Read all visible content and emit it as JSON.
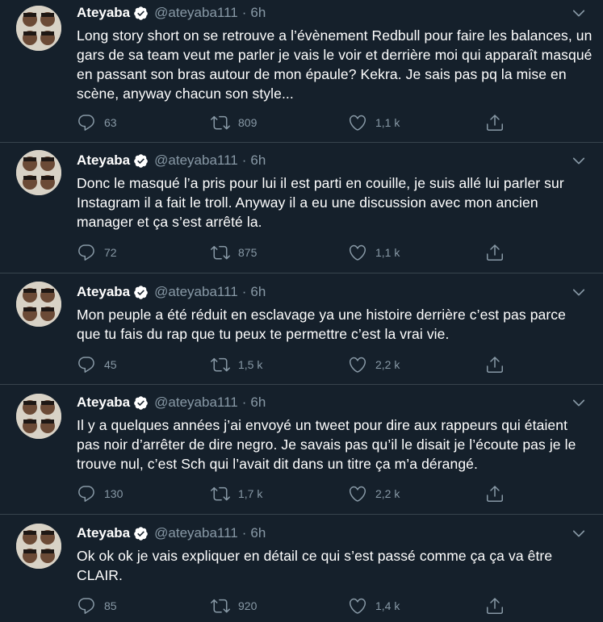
{
  "tweets": [
    {
      "name": "Ateyaba",
      "handle": "@ateyaba111",
      "separator": "·",
      "time": "6h",
      "text": "Long story short on se retrouve a l’évènement Redbull pour faire les balances, un gars de sa team veut me parler je vais le voir et derrière moi qui apparaît masqué en passant son bras autour de mon épaule? Kekra. Je sais pas pq la mise en scène, anyway chacun son style...",
      "replies": "63",
      "retweets": "809",
      "likes": "1,1 k"
    },
    {
      "name": "Ateyaba",
      "handle": "@ateyaba111",
      "separator": "·",
      "time": "6h",
      "text": "Donc le masqué l’a pris pour lui il est parti en couille, je suis allé lui parler sur Instagram il a fait le troll. Anyway il a eu une discussion avec mon ancien manager et ça s’est arrêté la.",
      "replies": "72",
      "retweets": "875",
      "likes": "1,1 k"
    },
    {
      "name": "Ateyaba",
      "handle": "@ateyaba111",
      "separator": "·",
      "time": "6h",
      "text": "Mon peuple a été réduit en esclavage ya une histoire derrière c’est pas parce que tu fais du rap que tu peux te permettre c’est la vrai vie.",
      "replies": "45",
      "retweets": "1,5 k",
      "likes": "2,2 k"
    },
    {
      "name": "Ateyaba",
      "handle": "@ateyaba111",
      "separator": "·",
      "time": "6h",
      "text": "Il y a quelques années j’ai envoyé un tweet pour dire aux rappeurs qui étaient pas noir d’arrêter de dire negro. Je savais pas qu’il le disait je l’écoute pas je le trouve nul, c’est Sch qui l’avait dit dans un titre ça m’a dérangé.",
      "replies": "130",
      "retweets": "1,7 k",
      "likes": "2,2 k"
    },
    {
      "name": "Ateyaba",
      "handle": "@ateyaba111",
      "separator": "·",
      "time": "6h",
      "text": "Ok ok ok je vais expliquer en détail ce qui s’est passé comme ça ça va être CLAIR.",
      "replies": "85",
      "retweets": "920",
      "likes": "1,4 k"
    }
  ],
  "colors": {
    "background": "#15202b",
    "divider": "#38444d",
    "muted": "#8899a6",
    "text": "#ffffff"
  },
  "icons": {
    "verified": "verified-badge-icon",
    "caret": "chevron-down-icon",
    "reply": "reply-icon",
    "retweet": "retweet-icon",
    "like": "heart-icon",
    "share": "share-icon"
  }
}
